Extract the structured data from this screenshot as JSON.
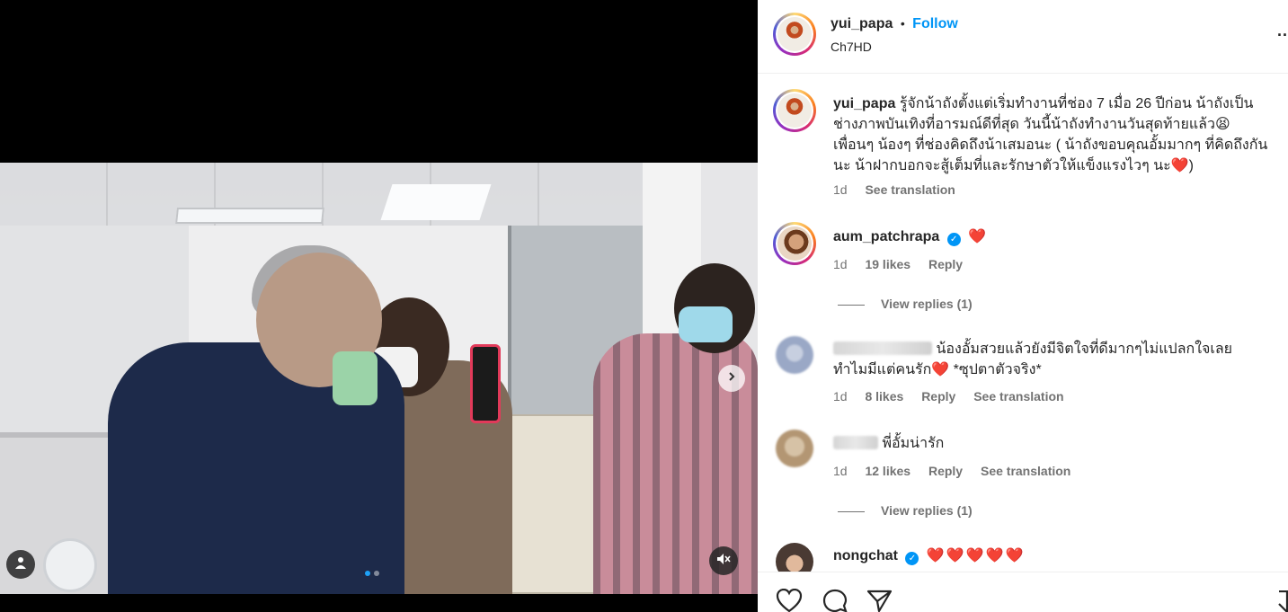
{
  "post": {
    "author": "yui_papa",
    "separator": "•",
    "follow_label": "Follow",
    "location": "Ch7HD",
    "more_label": "...",
    "caption_lines": [
      "รู้จักน้าถังตั้งแต่เริ่มทำงานที่ช่อง 7 เมื่อ 26 ปีก่อน น้าถังเป็น",
      "ช่างภาพบันเทิงที่อารมณ์ดีที่สุด วันนี้น้าถังทำงานวันสุดท้ายแล้ว😫",
      "เพื่อนๆ น้องๆ ที่ช่องคิดถึงน้าเสมอนะ ( น้าถังขอบคุณอั้มมากๆ ที่คิดถึงกัน",
      "นะ น้าฝากบอกจะสู้เต็มที่และรักษาตัวให้แข็งแรงไวๆ นะ❤️)"
    ],
    "caption_time": "1d",
    "caption_translate": "See translation"
  },
  "comments": [
    {
      "user": "aum_patchrapa",
      "verified": true,
      "text": "❤️",
      "time": "1d",
      "likes": "19 likes",
      "reply": "Reply",
      "translate": "",
      "view_replies": "View replies (1)"
    },
    {
      "user": "",
      "verified": false,
      "text_lines": [
        "น้องอั้มสวยแล้วยังมีจิตใจที่ดีมากๆไม่แปลกใจเลย",
        "ทำไมมีแต่คนรัก❤️ *ซุปตาตัวจริง*"
      ],
      "time": "1d",
      "likes": "8 likes",
      "reply": "Reply",
      "translate": "See translation"
    },
    {
      "user": "",
      "verified": false,
      "text": "พี่อั้มน่ารัก",
      "time": "1d",
      "likes": "12 likes",
      "reply": "Reply",
      "translate": "See translation",
      "view_replies": "View replies (1)"
    },
    {
      "user": "nongchat",
      "verified": true,
      "text": "❤️❤️❤️❤️❤️"
    }
  ],
  "media": {
    "slide_count": 2,
    "active_slide": 1
  },
  "colors": {
    "accent": "#0095f6",
    "heart": "#e0152b",
    "media_bg": "#000000"
  },
  "icons": [
    "user-tag-icon",
    "mute-icon",
    "chevron-right-icon",
    "heart-icon",
    "comment-icon",
    "share-icon",
    "bookmark-icon",
    "verified-icon",
    "more-icon"
  ]
}
